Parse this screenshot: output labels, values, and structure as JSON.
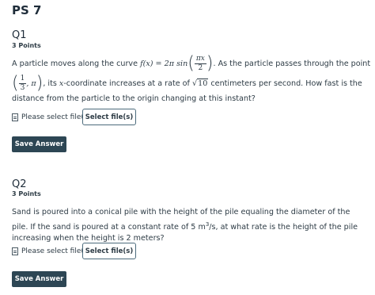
{
  "page": {
    "title": "PS 7"
  },
  "questions": [
    {
      "title": "Q1",
      "points": "3 Points",
      "text": {
        "intro": "A particle moves along the curve",
        "func": "f(x) = 2π sin",
        "arg_num": "πx",
        "arg_den": "2",
        "after_func": ". As the particle passes through the point",
        "point_num": "1",
        "point_den": "3",
        "point_y": ", π",
        "rate_pre": ", its",
        "var_x": "x",
        "rate_mid": "-coordinate increases at a rate of",
        "sqrt_sym": "√",
        "sqrt_val": "10",
        "rate_post": "centimeters per second. How fast is the",
        "line3": "distance from the particle to the origin changing at this instant?"
      },
      "file_label": "Please select file(s)",
      "select_button": "Select file(s)",
      "save_button": "Save Answer"
    },
    {
      "title": "Q2",
      "points": "3 Points",
      "text": {
        "part1": "Sand is poured into a conical pile with the height of the pile equaling the diameter of the pile. If the sand is poured at a constant rate of 5 m",
        "sup": "3",
        "part2": "/s, at what rate is the height of the pile increasing when the height is 2 meters?"
      },
      "file_label": "Please select file(s)",
      "select_button": "Select file(s)",
      "save_button": "Save Answer"
    }
  ],
  "icons": {
    "file": "file-icon"
  },
  "colors": {
    "save_bg": "#2d4654",
    "text": "#2d3b45",
    "button_border": "#4c6b7c"
  }
}
